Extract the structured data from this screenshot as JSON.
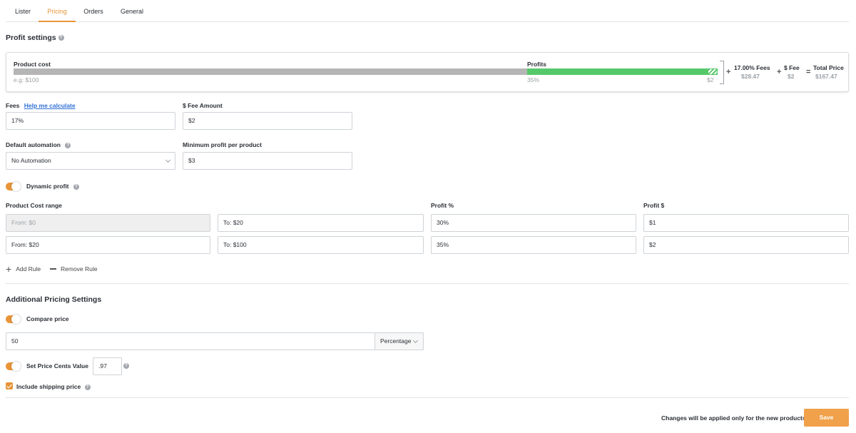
{
  "tabs": [
    "Lister",
    "Pricing",
    "Orders",
    "General"
  ],
  "profit_settings": {
    "title": "Profit settings",
    "product_cost_label": "Product cost",
    "product_cost_placeholder": "e.g: $100",
    "profits_label": "Profits",
    "profit_pct": "35%",
    "fee_amount_small": "$2",
    "plus1": "+",
    "fees_pct_label": "17.00% Fees",
    "fees_value": "$28.47",
    "plus2": "+",
    "fee_label": "$ Fee",
    "fee_value": "$2",
    "equals": "=",
    "total_label": "Total Price",
    "total_value": "$167.47"
  },
  "fees": {
    "label": "Fees",
    "help_link": "Help me calculate",
    "value": "17%"
  },
  "fee_amount": {
    "label": "$ Fee Amount",
    "value": "$2"
  },
  "automation": {
    "label": "Default automation",
    "value": "No Automation"
  },
  "min_profit": {
    "label": "Minimum profit per product",
    "value": "$3"
  },
  "dynamic_profit": {
    "label": "Dynamic profit",
    "enabled": true
  },
  "rules": {
    "headers": {
      "cost_range": "Product Cost range",
      "profit_pct": "Profit %",
      "profit_usd": "Profit $"
    },
    "rows": [
      {
        "from": "From: $0",
        "to": "To: $20",
        "pct": "30%",
        "usd": "$1"
      },
      {
        "from": "From: $20",
        "to": "To: $100",
        "pct": "35%",
        "usd": "$2"
      }
    ],
    "add_label": "Add Rule",
    "remove_label": "Remove Rule"
  },
  "additional": {
    "title": "Additional Pricing Settings",
    "compare_price_label": "Compare price",
    "compare_value": "50",
    "compare_type": "Percentage",
    "cents_label": "Set Price Cents Value",
    "cents_value": ".97",
    "shipping_label": "Include shipping price"
  },
  "footer": {
    "note": "Changes will be applied only for the new products",
    "save_label": "Save"
  },
  "colors": {
    "accent": "#e8953a",
    "profit_bar": "#55c86a",
    "cost_bar": "#b5b5b5",
    "link": "#2f6fd6"
  }
}
